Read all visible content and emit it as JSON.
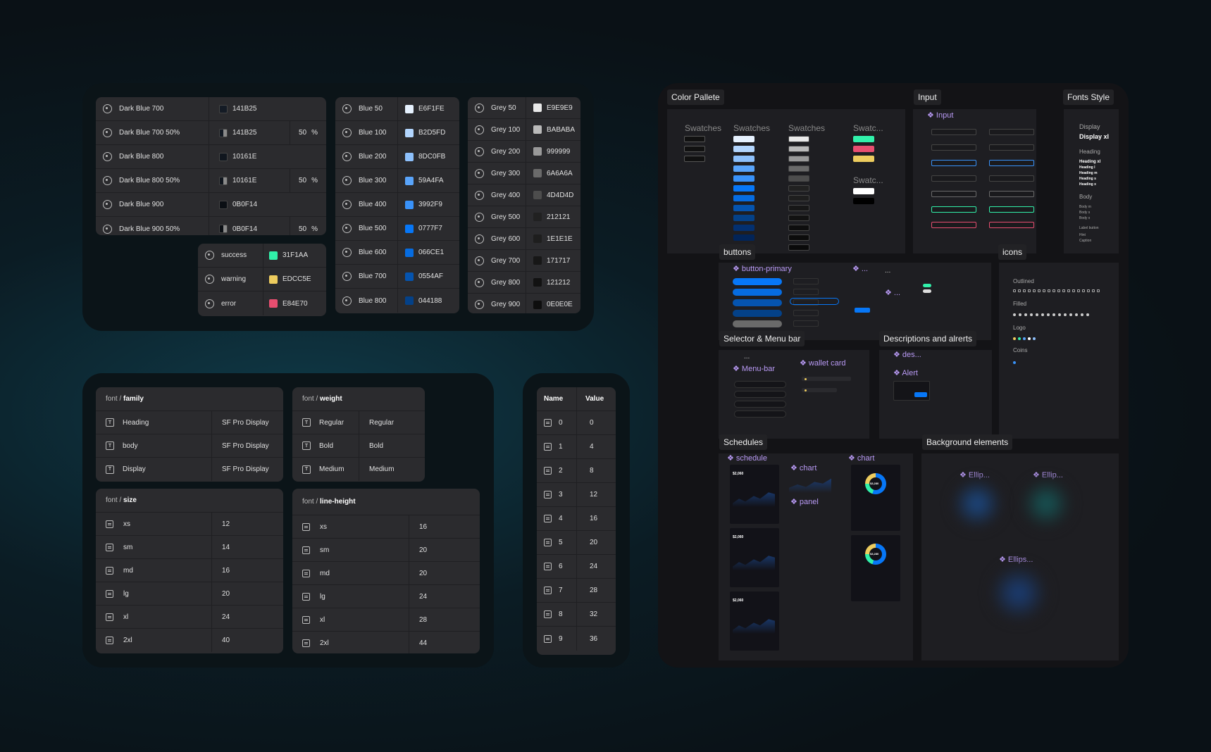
{
  "dark_blues": [
    {
      "name": "Dark Blue 700",
      "hex": "141B25",
      "opacity": "",
      "color": "#141B25",
      "half": false
    },
    {
      "name": "Dark Blue 700 50%",
      "hex": "141B25",
      "opacity": "50",
      "color": "#141B25",
      "half": true
    },
    {
      "name": "Dark Blue 800",
      "hex": "10161E",
      "opacity": "",
      "color": "#10161E",
      "half": false
    },
    {
      "name": "Dark Blue 800 50%",
      "hex": "10161E",
      "opacity": "50",
      "color": "#10161E",
      "half": true
    },
    {
      "name": "Dark Blue 900",
      "hex": "0B0F14",
      "opacity": "",
      "color": "#0B0F14",
      "half": false
    },
    {
      "name": "Dark Blue 900 50%",
      "hex": "0B0F14",
      "opacity": "50",
      "color": "#0B0F14",
      "half": true
    }
  ],
  "percent_sign": "%",
  "status_colors": [
    {
      "name": "success",
      "hex": "31F1AA",
      "color": "#31F1AA"
    },
    {
      "name": "warning",
      "hex": "EDCC5E",
      "color": "#EDCC5E"
    },
    {
      "name": "error",
      "hex": "E84E70",
      "color": "#E84E70"
    }
  ],
  "blues": [
    {
      "name": "Blue 50",
      "hex": "E6F1FE",
      "color": "#E6F1FE"
    },
    {
      "name": "Blue 100",
      "hex": "B2D5FD",
      "color": "#B2D5FD"
    },
    {
      "name": "Blue 200",
      "hex": "8DC0FB",
      "color": "#8DC0FB"
    },
    {
      "name": "Blue 300",
      "hex": "59A4FA",
      "color": "#59A4FA"
    },
    {
      "name": "Blue 400",
      "hex": "3992F9",
      "color": "#3992F9"
    },
    {
      "name": "Blue 500",
      "hex": "0777F7",
      "color": "#0777F7"
    },
    {
      "name": "Blue 600",
      "hex": "066CE1",
      "color": "#066CE1"
    },
    {
      "name": "Blue 700",
      "hex": "0554AF",
      "color": "#0554AF"
    },
    {
      "name": "Blue 800",
      "hex": "044188",
      "color": "#044188"
    }
  ],
  "greys": [
    {
      "name": "Grey 50",
      "hex": "E9E9E9",
      "color": "#E9E9E9"
    },
    {
      "name": "Grey 100",
      "hex": "BABABA",
      "color": "#BABABA"
    },
    {
      "name": "Grey 200",
      "hex": "999999",
      "color": "#999999"
    },
    {
      "name": "Grey 300",
      "hex": "6A6A6A",
      "color": "#6A6A6A"
    },
    {
      "name": "Grey 400",
      "hex": "4D4D4D",
      "color": "#4D4D4D"
    },
    {
      "name": "Grey 500",
      "hex": "212121",
      "color": "#212121"
    },
    {
      "name": "Grey 600",
      "hex": "1E1E1E",
      "color": "#1E1E1E"
    },
    {
      "name": "Grey 700",
      "hex": "171717",
      "color": "#171717"
    },
    {
      "name": "Grey 800",
      "hex": "121212",
      "color": "#121212"
    },
    {
      "name": "Grey 900",
      "hex": "0E0E0E",
      "color": "#0E0E0E"
    }
  ],
  "font_family": {
    "prefix": "font / ",
    "title": "family",
    "rows": [
      {
        "name": "Heading",
        "value": "SF Pro Display"
      },
      {
        "name": "body",
        "value": "SF Pro Display"
      },
      {
        "name": "Display",
        "value": "SF Pro Display"
      }
    ]
  },
  "font_weight": {
    "prefix": "font / ",
    "title": "weight",
    "rows": [
      {
        "name": "Regular",
        "value": "Regular"
      },
      {
        "name": "Bold",
        "value": "Bold"
      },
      {
        "name": "Medium",
        "value": "Medium"
      }
    ]
  },
  "font_size": {
    "prefix": "font / ",
    "title": "size",
    "rows": [
      {
        "name": "xs",
        "value": "12"
      },
      {
        "name": "sm",
        "value": "14"
      },
      {
        "name": "md",
        "value": "16"
      },
      {
        "name": "lg",
        "value": "20"
      },
      {
        "name": "xl",
        "value": "24"
      },
      {
        "name": "2xl",
        "value": "40"
      }
    ]
  },
  "font_line_height": {
    "prefix": "font / ",
    "title": "line-height",
    "rows": [
      {
        "name": "xs",
        "value": "16"
      },
      {
        "name": "sm",
        "value": "20"
      },
      {
        "name": "md",
        "value": "20"
      },
      {
        "name": "lg",
        "value": "24"
      },
      {
        "name": "xl",
        "value": "28"
      },
      {
        "name": "2xl",
        "value": "44"
      }
    ]
  },
  "spacing": {
    "name_header": "Name",
    "value_header": "Value",
    "rows": [
      {
        "name": "0",
        "value": "0"
      },
      {
        "name": "1",
        "value": "4"
      },
      {
        "name": "2",
        "value": "8"
      },
      {
        "name": "3",
        "value": "12"
      },
      {
        "name": "4",
        "value": "16"
      },
      {
        "name": "5",
        "value": "20"
      },
      {
        "name": "6",
        "value": "24"
      },
      {
        "name": "7",
        "value": "28"
      },
      {
        "name": "8",
        "value": "32"
      },
      {
        "name": "9",
        "value": "36"
      }
    ]
  },
  "canvas": {
    "color_pallete": "Color Pallete",
    "input": "Input",
    "fonts_style": "Fonts Style",
    "buttons": "buttons",
    "icons": "icons",
    "selector_menu": "Selector & Menu bar",
    "descriptions_alerts": "Descriptions and alrerts",
    "schedules": "Schedules",
    "background_elements": "Background elements",
    "swatches": [
      "Swatches",
      "Swatches",
      "Swatches",
      "Swatc...",
      "Swatc..."
    ],
    "input_component": "Input",
    "button_primary": "button-primary",
    "btn_more1": "...",
    "btn_more2": "...",
    "btn_more3": "...",
    "menu_more": "...",
    "menu_bar": "Menu-bar",
    "wallet_card": "wallet card",
    "des": "des...",
    "alert": "Alert",
    "schedule": "schedule",
    "chart_small": "chart",
    "panel": "panel",
    "chart": "chart",
    "ellipse1": "Ellip...",
    "ellipse2": "Ellip...",
    "ellipse3": "Ellips...",
    "fonts": [
      "Display",
      "Display xl",
      "Heading",
      "Heading xl",
      "Heading l",
      "Heading m",
      "Heading s",
      "Heading x",
      "Body",
      "Body m",
      "Body s",
      "Body x",
      "Label button",
      "Hint",
      "Caption"
    ],
    "icon_groups": [
      "Outlined",
      "Filled",
      "Logo",
      "Coins"
    ],
    "sched_value": "$2,060",
    "chart_value": "$3,280"
  },
  "colors": {
    "accent": "#0777F7",
    "component": "#B99AF5",
    "success": "#31F1AA"
  }
}
